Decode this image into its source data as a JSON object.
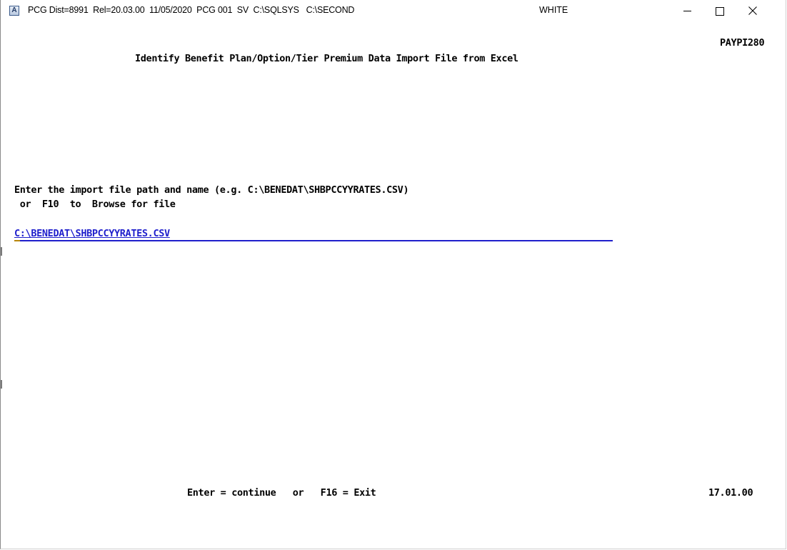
{
  "window": {
    "title": "PCG Dist=8991  Rel=20.03.00  11/05/2020  PCG 001  SV  C:\\SQLSYS   C:\\SECOND",
    "user": "WHITE",
    "app_icon_letter": "A",
    "controls": {
      "minimize_icon": "minimize-icon",
      "maximize_icon": "maximize-icon",
      "close_icon": "close-icon"
    }
  },
  "screen": {
    "program_id": "PAYPI280",
    "title": "Identify Benefit Plan/Option/Tier Premium Data Import File from Excel",
    "prompt_line1": "Enter the import file path and name (e.g. C:\\BENEDAT\\SHBPCCYYRATES.CSV)",
    "prompt_line2": " or  F10  to  Browse for file",
    "file_path_value": "C:\\BENEDAT\\SHBPCCYYRATES.CSV",
    "footer": "Enter = continue   or   F16 = Exit",
    "time": "17.01.00"
  },
  "colors": {
    "input_text": "#1f1fcc",
    "cursor": "#b8860b",
    "background": "#ffffff"
  }
}
